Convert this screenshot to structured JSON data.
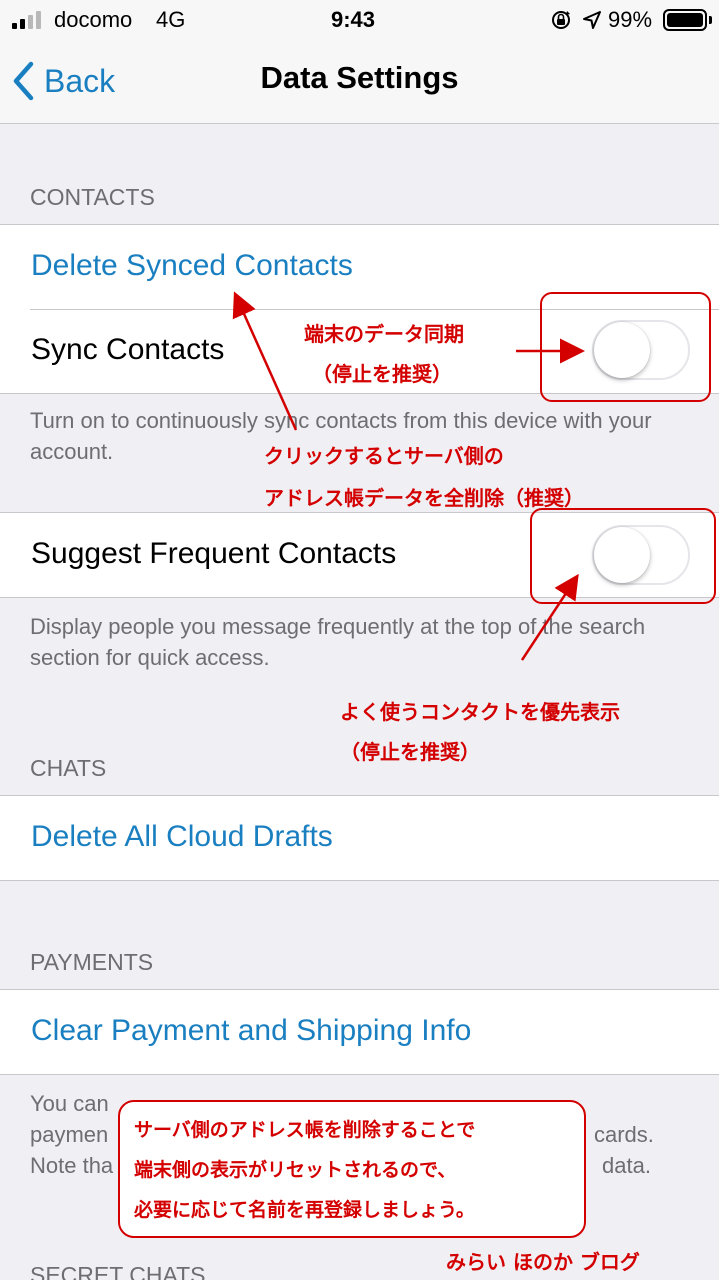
{
  "status_bar": {
    "carrier": "docomo",
    "network": "4G",
    "time": "9:43",
    "battery": "99%",
    "battery_level": 0.99
  },
  "nav": {
    "back_label": "Back",
    "title": "Data Settings"
  },
  "contacts": {
    "header": "CONTACTS",
    "delete_synced": "Delete Synced Contacts",
    "sync_contacts": {
      "label": "Sync Contacts",
      "on": false
    },
    "sync_footer": "Turn on to continuously sync contacts from this device with your account.",
    "suggest_frequent": {
      "label": "Suggest Frequent Contacts",
      "on": false
    },
    "suggest_footer": "Display people you message frequently at the top of the search section for quick access."
  },
  "chats": {
    "header": "CHATS",
    "delete_drafts": "Delete All Cloud Drafts"
  },
  "payments": {
    "header": "PAYMENTS",
    "clear_info": "Clear Payment and Shipping Info",
    "footer_visible": {
      "line1": "You can",
      "line2_start": "paymen",
      "line2_end": "cards.",
      "line3_start": "Note tha",
      "line3_end": "data."
    }
  },
  "secret_chats": {
    "header": "SECRET CHATS"
  },
  "annotations": {
    "sync_note_line1": "端末のデータ同期",
    "sync_note_line2": "（停止を推奨）",
    "delete_note_line1": "クリックするとサーバ側の",
    "delete_note_line2": "アドレス帳データを全削除（推奨）",
    "suggest_note_line1": "よく使うコンタクトを優先表示",
    "suggest_note_line2": "（停止を推奨）",
    "box_line1": "サーバ側のアドレス帳を削除することで",
    "box_line2": "端末側の表示がリセットされるので、",
    "box_line3": "必要に応じて名前を再登録しましょう。",
    "watermark": "みらい ほのか ブログ"
  },
  "colors": {
    "accent": "#1a7fc1",
    "annotation": "#d40000",
    "background": "#efeff4"
  }
}
